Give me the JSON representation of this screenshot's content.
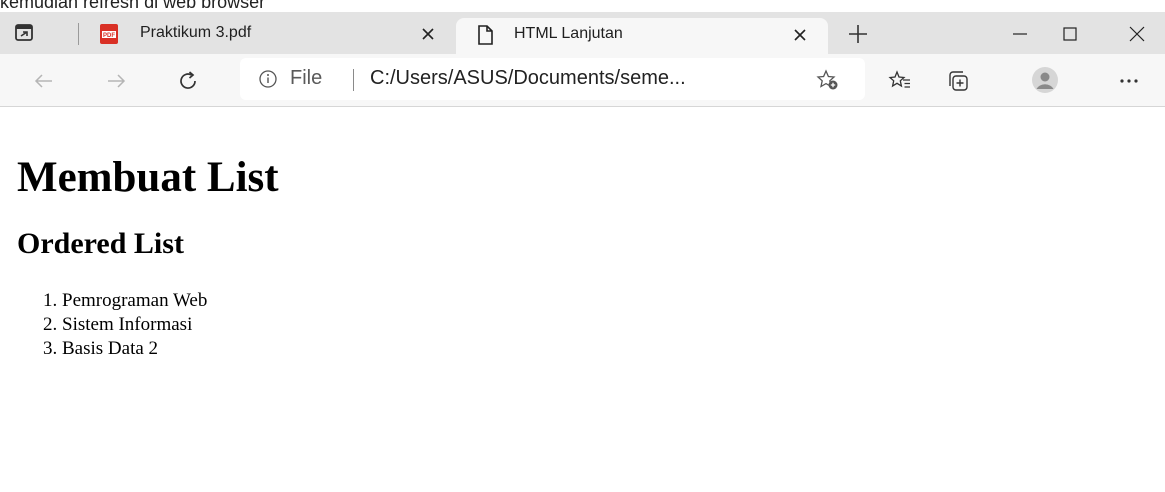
{
  "page_caption": "kemudian refresh di web browser",
  "tabs": [
    {
      "title": "Praktikum 3.pdf",
      "active": false,
      "icon": "pdf-icon"
    },
    {
      "title": "HTML Lanjutan",
      "active": true,
      "icon": "page-icon"
    }
  ],
  "address_bar": {
    "scheme_label": "File",
    "url": "C:/Users/ASUS/Documents/seme..."
  },
  "page": {
    "h1": "Membuat List",
    "h2": "Ordered List",
    "list_items": [
      "Pemrograman Web",
      "Sistem Informasi",
      "Basis Data 2"
    ]
  },
  "colors": {
    "tabbar_bg": "#e3e3e3",
    "active_tab_bg": "#f7f7f7",
    "pdf_red": "#d93025"
  }
}
